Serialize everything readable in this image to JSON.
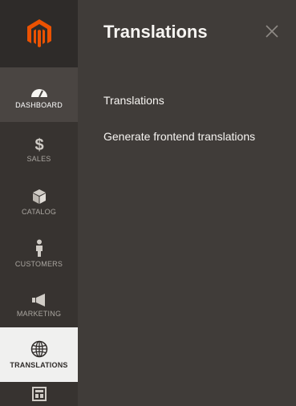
{
  "sidebar": {
    "items": [
      {
        "label": "DASHBOARD",
        "icon": "dashboard-gauge-icon"
      },
      {
        "label": "SALES",
        "icon": "dollar-icon"
      },
      {
        "label": "CATALOG",
        "icon": "box-icon"
      },
      {
        "label": "CUSTOMERS",
        "icon": "person-icon"
      },
      {
        "label": "MARKETING",
        "icon": "megaphone-icon"
      },
      {
        "label": "TRANSLATIONS",
        "icon": "globe-icon"
      },
      {
        "label": "",
        "icon": "layout-icon"
      }
    ]
  },
  "flyout": {
    "title": "Translations",
    "links": [
      {
        "label": "Translations"
      },
      {
        "label": "Generate frontend translations"
      }
    ]
  },
  "colors": {
    "brand": "#eb5202",
    "sidebar_bg": "#373330",
    "flyout_bg": "#403c39",
    "active_bg": "#f0f0ef"
  }
}
